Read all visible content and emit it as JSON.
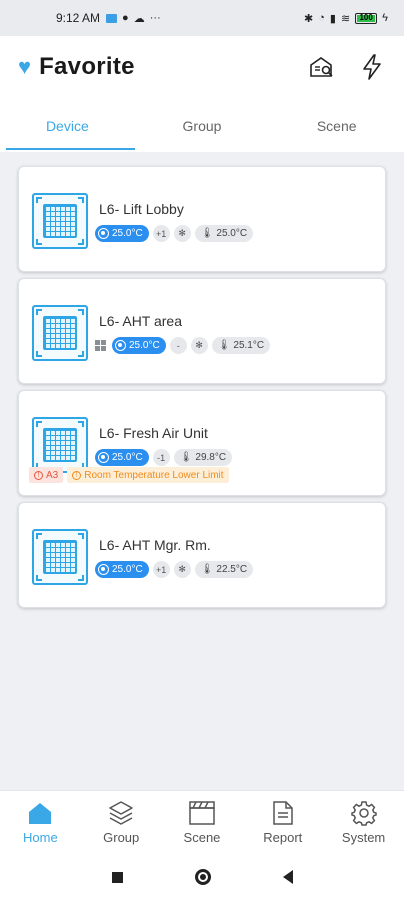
{
  "status_bar": {
    "time": "9:12 AM",
    "dots": "···",
    "battery": "100"
  },
  "header": {
    "title": "Favorite",
    "heart_icon": "heart-icon",
    "actions": [
      "report-search-icon",
      "lightning-icon"
    ]
  },
  "tabs": [
    {
      "label": "Device",
      "active": true
    },
    {
      "label": "Group",
      "active": false
    },
    {
      "label": "Scene",
      "active": false
    }
  ],
  "devices": [
    {
      "name": "L6- Lift Lobby",
      "set_temp": "25.0°C",
      "mode": "+1",
      "fan": "fan-icon",
      "room_temp": "25.0°C"
    },
    {
      "name": "L6- AHT area",
      "set_temp": "25.0°C",
      "mode": "-",
      "fan": "fan-icon",
      "room_temp": "25.1°C"
    },
    {
      "name": "L6- Fresh Air Unit",
      "set_temp": "25.0°C",
      "mode": "-1",
      "fan": "fan-icon",
      "room_temp": "29.8°C",
      "alarm_code": "A3",
      "alarm_text": "Room Temperature Lower Limit"
    },
    {
      "name": "L6- AHT Mgr. Rm.",
      "set_temp": "25.0°C",
      "mode": "+1",
      "fan": "fan-icon",
      "room_temp": "22.5°C"
    }
  ],
  "bottom_nav": [
    {
      "label": "Home",
      "active": true
    },
    {
      "label": "Group",
      "active": false
    },
    {
      "label": "Scene",
      "active": false
    },
    {
      "label": "Report",
      "active": false
    },
    {
      "label": "System",
      "active": false
    }
  ],
  "colors": {
    "accent": "#3aa8e6",
    "chip_blue": "#2b8ff0",
    "alarm_red": "#e4573d",
    "alarm_orange": "#f08c1c"
  }
}
